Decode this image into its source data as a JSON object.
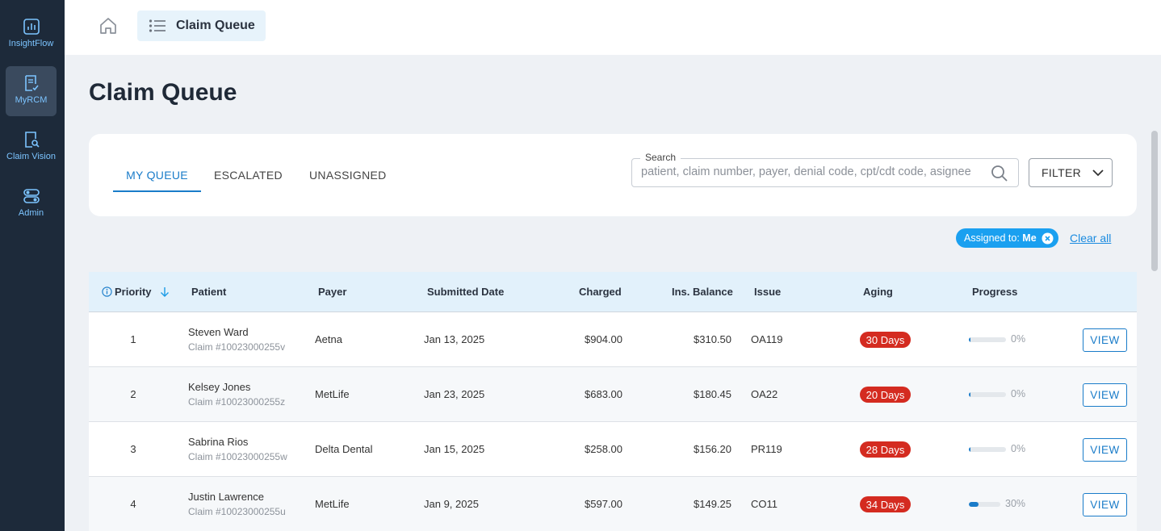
{
  "sidebar": {
    "items": [
      {
        "label": "InsightFlow",
        "icon": "bar-chart-icon"
      },
      {
        "label": "MyRCM",
        "icon": "document-check-icon",
        "active": true
      },
      {
        "label": "Claim Vision",
        "icon": "document-search-icon"
      },
      {
        "label": "Admin",
        "icon": "toggles-icon"
      }
    ]
  },
  "topbar": {
    "breadcrumb": "Claim Queue"
  },
  "page": {
    "title": "Claim Queue"
  },
  "tabs": [
    "MY QUEUE",
    "ESCALATED",
    "UNASSIGNED"
  ],
  "search": {
    "label": "Search",
    "placeholder": "patient, claim number, payer, denial code, cpt/cdt code, asignee"
  },
  "filter": {
    "label": "FILTER"
  },
  "chips": {
    "assigned_prefix": "Assigned to:",
    "assigned_value": "Me",
    "clear_all": "Clear all"
  },
  "table": {
    "headers": {
      "priority": "Priority",
      "patient": "Patient",
      "payer": "Payer",
      "submitted": "Submitted Date",
      "charged": "Charged",
      "balance": "Ins. Balance",
      "issue": "Issue",
      "aging": "Aging",
      "progress": "Progress"
    },
    "view_label": "VIEW",
    "rows": [
      {
        "priority": "1",
        "patient": "Steven Ward",
        "claim": "Claim #10023000255v",
        "payer": "Aetna",
        "submitted": "Jan 13, 2025",
        "charged": "$904.00",
        "balance": "$310.50",
        "issue": "OA119",
        "aging": "30 Days",
        "progress": 0,
        "progress_label": "0%"
      },
      {
        "priority": "2",
        "patient": "Kelsey Jones",
        "claim": "Claim #10023000255z",
        "payer": "MetLife",
        "submitted": "Jan 23, 2025",
        "charged": "$683.00",
        "balance": "$180.45",
        "issue": "OA22",
        "aging": "20 Days",
        "progress": 0,
        "progress_label": "0%"
      },
      {
        "priority": "3",
        "patient": "Sabrina Rios",
        "claim": "Claim #10023000255w",
        "payer": "Delta Dental",
        "submitted": "Jan 15, 2025",
        "charged": "$258.00",
        "balance": "$156.20",
        "issue": "PR119",
        "aging": "28 Days",
        "progress": 0,
        "progress_label": "0%"
      },
      {
        "priority": "4",
        "patient": "Justin Lawrence",
        "claim": "Claim #10023000255u",
        "payer": "MetLife",
        "submitted": "Jan 9, 2025",
        "charged": "$597.00",
        "balance": "$149.25",
        "issue": "CO11",
        "aging": "34 Days",
        "progress": 30,
        "progress_label": "30%"
      }
    ]
  },
  "colors": {
    "sidebar_bg": "#1d2a3a",
    "accent": "#1a7cc9",
    "aging_badge": "#d42b20",
    "chip": "#1aa0f0"
  }
}
